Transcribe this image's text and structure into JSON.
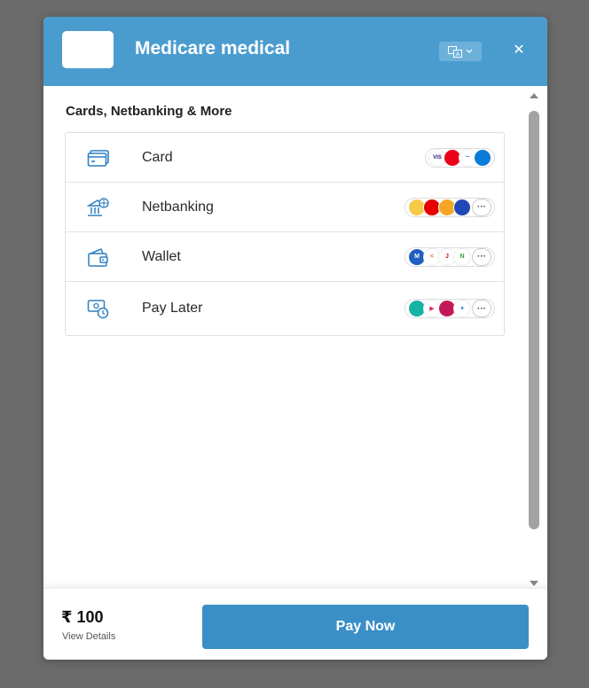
{
  "header": {
    "merchant_name": "Medicare medical",
    "language_icon": "translate-icon",
    "language_chevron": "chevron-down-icon",
    "close_label": "✕"
  },
  "methods_section": {
    "title": "Cards, Netbanking & More",
    "items": [
      {
        "label": "Card",
        "icon": "card-icon",
        "badges": [
          "VISA",
          "Mastercard",
          "RuPay",
          "Maestro"
        ]
      },
      {
        "label": "Netbanking",
        "icon": "bank-icon",
        "badges": [
          "Axis",
          "Airtel",
          "Canara",
          "Union"
        ],
        "more": "···"
      },
      {
        "label": "Wallet",
        "icon": "wallet-icon",
        "badges": [
          "Mobikwik",
          "Freecharge",
          "Jio",
          "Ola"
        ],
        "more": "···"
      },
      {
        "label": "Pay Later",
        "icon": "pay-later-icon",
        "badges": [
          "Simpl",
          "LazyPay",
          "ICICI",
          "HDFC"
        ],
        "more": "···"
      }
    ]
  },
  "footer": {
    "amount": "₹ 100",
    "view_details": "View Details",
    "pay_button": "Pay Now"
  },
  "colors": {
    "header_bg": "#4a9ccf",
    "pay_button_bg": "#3a8fc7",
    "overlay_bg": "#6b6b6b"
  }
}
